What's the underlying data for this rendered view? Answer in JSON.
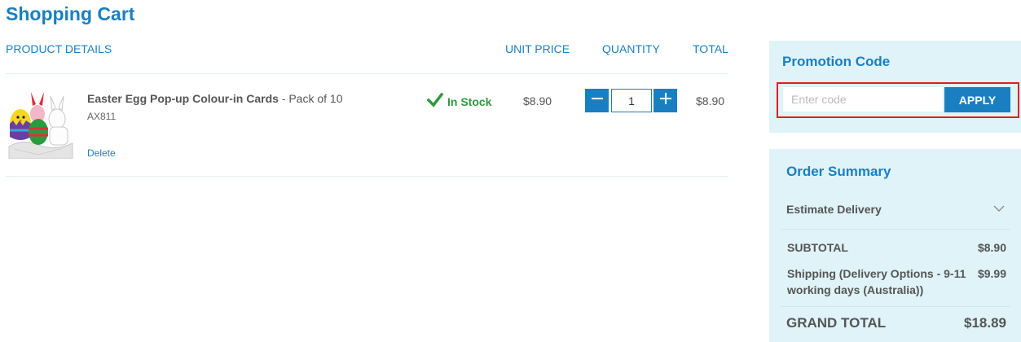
{
  "page_title": "Shopping Cart",
  "columns": {
    "product": "PRODUCT DETAILS",
    "unit_price": "UNIT PRICE",
    "quantity": "QUANTITY",
    "total": "TOTAL"
  },
  "item": {
    "name": "Easter Egg Pop-up Colour-in Cards",
    "variant": " - Pack of 10",
    "sku": "AX811",
    "delete_label": "Delete",
    "stock": "In Stock",
    "unit_price": "$8.90",
    "quantity": "1",
    "total": "$8.90"
  },
  "promo": {
    "title": "Promotion Code",
    "placeholder": "Enter code",
    "apply_label": "APPLY"
  },
  "summary": {
    "title": "Order Summary",
    "estimate_delivery": "Estimate Delivery",
    "subtotal_label": "SUBTOTAL",
    "subtotal_value": "$8.90",
    "shipping_label_line1": "Shipping (Delivery Options - 9-11",
    "shipping_label_line2": "working days (Australia))",
    "shipping_value": "$9.99",
    "grand_total_label": "GRAND TOTAL",
    "grand_total_value": "$18.89"
  },
  "colors": {
    "accent": "#1a7fc1",
    "stock_green": "#2e9a3e",
    "panel_bg": "#dff3f8",
    "highlight_red": "#e01e1e"
  }
}
